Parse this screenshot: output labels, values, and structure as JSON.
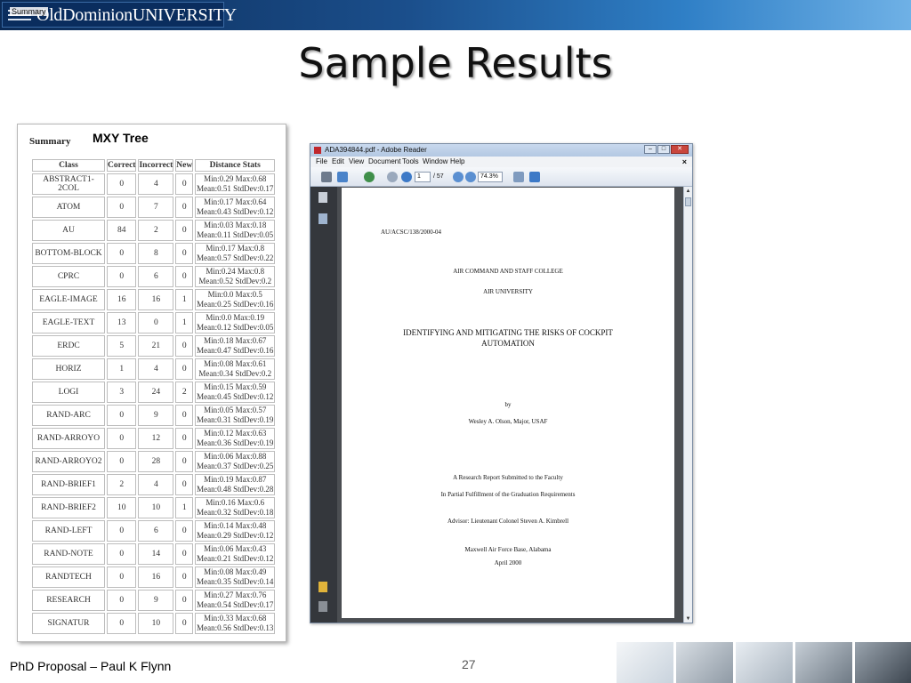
{
  "header": {
    "logo_text": "OldDominionUNIVERSITY",
    "overlay_text": "Summary"
  },
  "slide": {
    "title": "Sample Results",
    "footer_left": "PhD Proposal – Paul K Flynn",
    "page_number": "27"
  },
  "table_panel": {
    "summary_heading": "Summary",
    "label": "MXY Tree",
    "columns": [
      "Class",
      "Correct",
      "Incorrect",
      "New",
      "Distance Stats"
    ],
    "rows": [
      {
        "cls": "ABSTRACT1-2COL",
        "correct": "0",
        "incorrect": "4",
        "new": "0",
        "d1": "Min:0.29 Max:0.68",
        "d2": "Mean:0.51 StdDev:0.17"
      },
      {
        "cls": "ATOM",
        "correct": "0",
        "incorrect": "7",
        "new": "0",
        "d1": "Min:0.17 Max:0.64",
        "d2": "Mean:0.43 StdDev:0.12"
      },
      {
        "cls": "AU",
        "correct": "84",
        "incorrect": "2",
        "new": "0",
        "d1": "Min:0.03 Max:0.18",
        "d2": "Mean:0.11 StdDev:0.05"
      },
      {
        "cls": "BOTTOM-BLOCK",
        "correct": "0",
        "incorrect": "8",
        "new": "0",
        "d1": "Min:0.17 Max:0.8",
        "d2": "Mean:0.57 StdDev:0.22"
      },
      {
        "cls": "CPRC",
        "correct": "0",
        "incorrect": "6",
        "new": "0",
        "d1": "Min:0.24 Max:0.8",
        "d2": "Mean:0.52 StdDev:0.2"
      },
      {
        "cls": "EAGLE-IMAGE",
        "correct": "16",
        "incorrect": "16",
        "new": "1",
        "d1": "Min:0.0 Max:0.5",
        "d2": "Mean:0.25 StdDev:0.16"
      },
      {
        "cls": "EAGLE-TEXT",
        "correct": "13",
        "incorrect": "0",
        "new": "1",
        "d1": "Min:0.0 Max:0.19",
        "d2": "Mean:0.12 StdDev:0.05"
      },
      {
        "cls": "ERDC",
        "correct": "5",
        "incorrect": "21",
        "new": "0",
        "d1": "Min:0.18 Max:0.67",
        "d2": "Mean:0.47 StdDev:0.16"
      },
      {
        "cls": "HORIZ",
        "correct": "1",
        "incorrect": "4",
        "new": "0",
        "d1": "Min:0.08 Max:0.61",
        "d2": "Mean:0.34 StdDev:0.2"
      },
      {
        "cls": "LOGI",
        "correct": "3",
        "incorrect": "24",
        "new": "2",
        "d1": "Min:0.15 Max:0.59",
        "d2": "Mean:0.45 StdDev:0.12"
      },
      {
        "cls": "RAND-ARC",
        "correct": "0",
        "incorrect": "9",
        "new": "0",
        "d1": "Min:0.05 Max:0.57",
        "d2": "Mean:0.31 StdDev:0.19"
      },
      {
        "cls": "RAND-ARROYO",
        "correct": "0",
        "incorrect": "12",
        "new": "0",
        "d1": "Min:0.12 Max:0.63",
        "d2": "Mean:0.36 StdDev:0.19"
      },
      {
        "cls": "RAND-ARROYO2",
        "correct": "0",
        "incorrect": "28",
        "new": "0",
        "d1": "Min:0.06 Max:0.88",
        "d2": "Mean:0.37 StdDev:0.25"
      },
      {
        "cls": "RAND-BRIEF1",
        "correct": "2",
        "incorrect": "4",
        "new": "0",
        "d1": "Min:0.19 Max:0.87",
        "d2": "Mean:0.48 StdDev:0.28"
      },
      {
        "cls": "RAND-BRIEF2",
        "correct": "10",
        "incorrect": "10",
        "new": "1",
        "d1": "Min:0.16 Max:0.6",
        "d2": "Mean:0.32 StdDev:0.18"
      },
      {
        "cls": "RAND-LEFT",
        "correct": "0",
        "incorrect": "6",
        "new": "0",
        "d1": "Min:0.14 Max:0.48",
        "d2": "Mean:0.29 StdDev:0.12"
      },
      {
        "cls": "RAND-NOTE",
        "correct": "0",
        "incorrect": "14",
        "new": "0",
        "d1": "Min:0.06 Max:0.43",
        "d2": "Mean:0.21 StdDev:0.12"
      },
      {
        "cls": "RANDTECH",
        "correct": "0",
        "incorrect": "16",
        "new": "0",
        "d1": "Min:0.08 Max:0.49",
        "d2": "Mean:0.35 StdDev:0.14"
      },
      {
        "cls": "RESEARCH",
        "correct": "0",
        "incorrect": "9",
        "new": "0",
        "d1": "Min:0.27 Max:0.76",
        "d2": "Mean:0.54 StdDev:0.17"
      },
      {
        "cls": "SIGNATUR",
        "correct": "0",
        "incorrect": "10",
        "new": "0",
        "d1": "Min:0.33 Max:0.68",
        "d2": "Mean:0.56 StdDev:0.13"
      }
    ]
  },
  "reader": {
    "window_title": "ADA394844.pdf - Adobe Reader",
    "menus": [
      "File",
      "Edit",
      "View",
      "Document",
      "Tools",
      "Window",
      "Help"
    ],
    "page_input": "1",
    "page_total": "/ 57",
    "zoom": "74.3%",
    "doc": {
      "id": "AU/ACSC/138/2000-04",
      "college": "AIR COMMAND AND STAFF COLLEGE",
      "university": "AIR UNIVERSITY",
      "title_line1": "IDENTIFYING AND MITIGATING THE RISKS OF COCKPIT",
      "title_line2": "AUTOMATION",
      "by": "by",
      "author": "Wesley A. Olson, Major, USAF",
      "report_line1": "A Research Report Submitted to the Faculty",
      "report_line2": "In Partial Fulfillment of the Graduation Requirements",
      "advisor": "Advisor: Lieutenant Colonel Steven A. Kimbrell",
      "location": "Maxwell Air Force Base, Alabama",
      "date": "April 2000"
    }
  }
}
